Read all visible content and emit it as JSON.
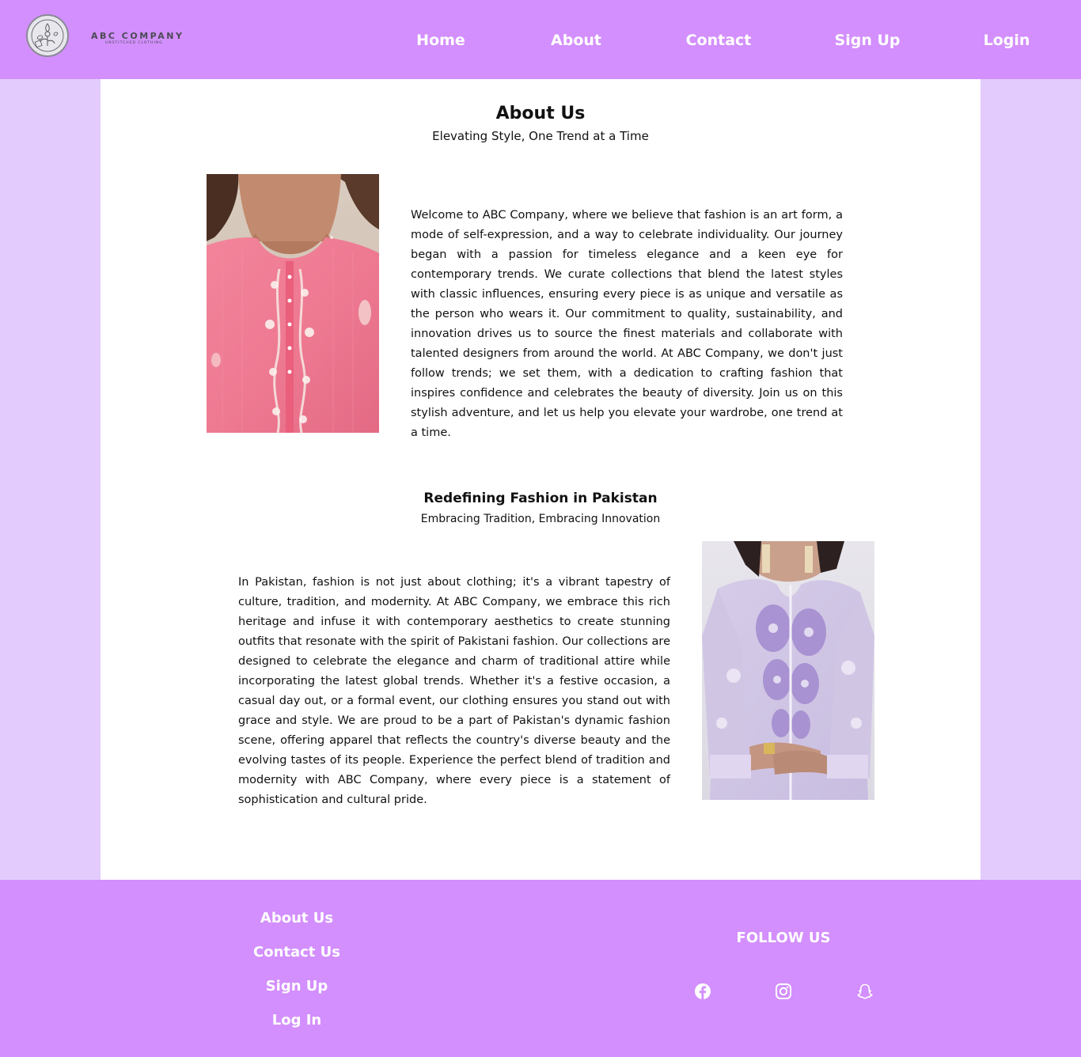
{
  "header": {
    "logo": {
      "name": "ABC COMPANY",
      "tagline": "UNSTITCHED CLOTHING"
    },
    "nav": [
      {
        "label": "Home"
      },
      {
        "label": "About"
      },
      {
        "label": "Contact"
      },
      {
        "label": "Sign Up"
      },
      {
        "label": "Login"
      }
    ]
  },
  "main": {
    "title": "About Us",
    "subtitle": "Elevating Style, One Trend at a Time",
    "about_paragraph": "Welcome to ABC Company, where we believe that fashion is an art form, a mode of self-expression, and a way to celebrate individuality. Our journey began with a passion for timeless elegance and a keen eye for contemporary trends. We curate collections that blend the latest styles with classic influences, ensuring every piece is as unique and versatile as the person who wears it. Our commitment to quality, sustainability, and innovation drives us to source the finest materials and collaborate with talented designers from around the world. At ABC Company, we don't just follow trends; we set them, with a dedication to crafting fashion that inspires confidence and celebrates the beauty of diversity. Join us on this stylish adventure, and let us help you elevate your wardrobe, one trend at a time.",
    "section2": {
      "title": "Redefining Fashion in Pakistan",
      "subtitle": "Embracing Tradition, Embracing Innovation",
      "paragraph": "In Pakistan, fashion is not just about clothing; it's a vibrant tapestry of culture, tradition, and modernity. At ABC Company, we embrace this rich heritage and infuse it with contemporary aesthetics to create stunning outfits that resonate with the spirit of Pakistani fashion. Our collections are designed to celebrate the elegance and charm of traditional attire while incorporating the latest global trends. Whether it's a festive occasion, a casual day out, or a formal event, our clothing ensures you stand out with grace and style. We are proud to be a part of Pakistan's dynamic fashion scene, offering apparel that reflects the country's diverse beauty and the evolving tastes of its people. Experience the perfect blend of tradition and modernity with ABC Company, where every piece is a statement of sophistication and cultural pride."
    }
  },
  "footer": {
    "links": [
      {
        "label": "About Us"
      },
      {
        "label": "Contact Us"
      },
      {
        "label": "Sign Up"
      },
      {
        "label": "Log In"
      }
    ],
    "follow_heading": "FOLLOW US",
    "social_icons": [
      "facebook-icon",
      "instagram-icon",
      "snapchat-icon"
    ]
  },
  "colors": {
    "header_footer_bg": "#d38ffd",
    "page_bg": "#e3ccfd",
    "panel_bg": "#ffffff",
    "nav_text": "#ffffff"
  }
}
